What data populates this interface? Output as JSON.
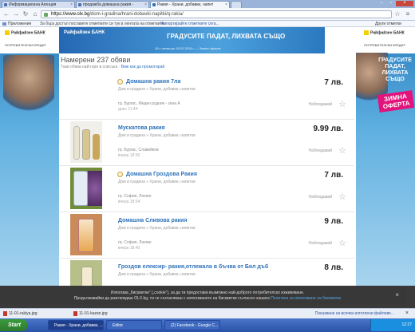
{
  "browser": {
    "tabs": [
      {
        "label": "Информационна Агенция"
      },
      {
        "label": "продажба домашна ракия -"
      },
      {
        "label": "Ракия - Храни, добавки, напит"
      },
      {
        "label": ""
      }
    ],
    "url_host": "https://www.olx.bg",
    "url_path": "/dom-i-gradina/hrani-dobavki-napitki/q-rakia/",
    "bookmarks": [
      {
        "label": "Приложения"
      },
      {
        "label": "За бърз достъп поставете отметките си тук в лентата на отметките."
      },
      {
        "label": "Импортирайте отметките сега..."
      }
    ],
    "other_bookmarks": "Други отметки"
  },
  "ads": {
    "left_logo": "Райфайзен БАНК",
    "left_side_text": "ПОТРЕБИТЕЛСКИ КРЕДИТ",
    "right_logo": "Райфайзен БАНК",
    "right_side_text": "ПОТРЕБИТЕЛСКИ КРЕДИТ",
    "right_promo": "ГРАДУСИТЕ ПАДАТ, ЛИХВАТА СЪЩО",
    "right_winter": "ЗИМНА ОФЕРТА",
    "banner_logo": "Райфайзен БАНК",
    "banner_text": "ГРАДУСИТЕ ПАДАТ, ЛИХВАТА СЪЩО",
    "banner_fine": "16 с лихва до 18.02.2015 г. — Зимна оферта"
  },
  "results": {
    "heading": "Намерени 237 обяви",
    "sub": "Тази обява най-горе в списъка",
    "sub_link": "Виж как да промотирай"
  },
  "listings": [
    {
      "title": "Домашна ракия 7ла",
      "category": "Дом и градина » Храни, добавки, напитки",
      "location": "гр. Бургас, Меден рудник - зона А",
      "time": "днес 11:44",
      "price": "7 лв.",
      "watch": "Наблюдавай",
      "has_image": false
    },
    {
      "title": "Мускатова ракия",
      "category": "Дом и градина » Храни, добавки, напитки",
      "location": "гр. Бургас, Славейков",
      "time": "вчера 18:50",
      "price": "9.99 лв.",
      "watch": "Наблюдавай",
      "has_image": true
    },
    {
      "title": "Домашна Гроздова Ракия",
      "category": "Дом и градина » Храни, добавки, напитки",
      "location": "гр. София, Люлин",
      "time": "вчера 18:54",
      "price": "7 лв.",
      "watch": "Наблюдавай",
      "has_image": true
    },
    {
      "title": "Домашна Сливова ракия",
      "category": "Дом и градина » Храни, добавки, напитки",
      "location": "гр. София, Люлин",
      "time": "вчера 18:40",
      "price": "9 лв.",
      "watch": "Наблюдавай",
      "has_image": true
    },
    {
      "title": "Гроздов елексир- ракия,отлежала в бъчва от Бял дъб",
      "category": "Дом и градина » Храни, добавки, напитки",
      "location": "",
      "time": "",
      "price": "8 лв.",
      "watch": "",
      "has_image": true
    }
  ],
  "cookie": {
    "text1": "Използва „бисквитки“ („cookie“), за да ти предостави възможно най-доброто потребителско изживяване.",
    "text2": "Продължавайки да разглеждаш OLX.bg, ти се съгласяваш с използването на бисквитки съгласно нашата",
    "link": "Политика за използване на бисквитки"
  },
  "downloads": {
    "items": [
      {
        "label": "11-01-rakiya.jpg"
      },
      {
        "label": "11-01-kazan.jpg"
      }
    ],
    "show_all": "Показване на всички изтеглени файлове..."
  },
  "taskbar": {
    "start": "Start",
    "tasks": [
      {
        "label": "Ракия - Храни, добавки, ..."
      },
      {
        "label": "Editor"
      },
      {
        "label": "(2) Facebook - Google C..."
      }
    ],
    "clock": "12:27"
  }
}
